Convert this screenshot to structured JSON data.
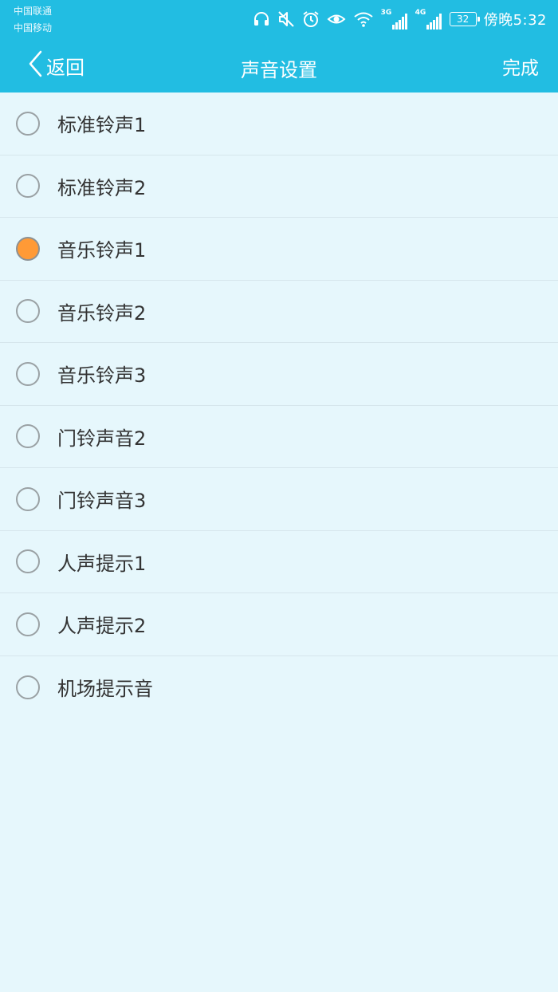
{
  "status_bar": {
    "carrier_1": "中国联通",
    "carrier_2": "中国移动",
    "network_1": "3G",
    "network_2": "4G",
    "battery": "32",
    "time": "傍晚5:32",
    "icons": [
      "headset-icon",
      "mute-icon",
      "alarm-icon",
      "eye-icon",
      "wifi-icon",
      "signal-icon",
      "signal-icon",
      "battery-icon"
    ]
  },
  "nav": {
    "back_label": "返回",
    "title": "声音设置",
    "done_label": "完成"
  },
  "sounds": [
    {
      "label": "标准铃声1",
      "selected": false
    },
    {
      "label": "标准铃声2",
      "selected": false
    },
    {
      "label": "音乐铃声1",
      "selected": true
    },
    {
      "label": "音乐铃声2",
      "selected": false
    },
    {
      "label": "音乐铃声3",
      "selected": false
    },
    {
      "label": "门铃声音2",
      "selected": false
    },
    {
      "label": "门铃声音3",
      "selected": false
    },
    {
      "label": "人声提示1",
      "selected": false
    },
    {
      "label": "人声提示2",
      "selected": false
    },
    {
      "label": "机场提示音",
      "selected": false
    }
  ],
  "colors": {
    "header": "#22bde2",
    "background": "#e6f7fc",
    "selected_radio": "#ff9a36",
    "text": "#333333"
  }
}
